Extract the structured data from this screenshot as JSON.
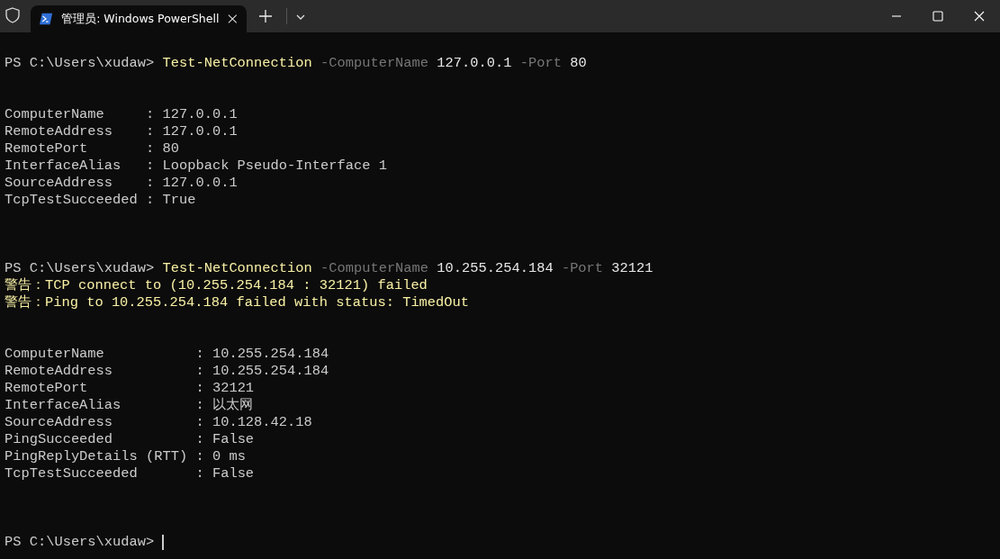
{
  "window": {
    "tab_title": "管理员: Windows PowerShell"
  },
  "lines": [
    {
      "kind": "prompt",
      "prompt": "PS C:\\Users\\xudaw>",
      "command": "Test-NetConnection",
      "args": [
        {
          "kind": "param",
          "text": "-ComputerName"
        },
        {
          "kind": "value",
          "text": "127.0.0.1"
        },
        {
          "kind": "param",
          "text": "-Port"
        },
        {
          "kind": "value",
          "text": "80"
        }
      ]
    },
    {
      "kind": "blank"
    },
    {
      "kind": "blank"
    },
    {
      "kind": "properties",
      "separator": ":",
      "items": [
        {
          "key": "ComputerName",
          "value": "127.0.0.1"
        },
        {
          "key": "RemoteAddress",
          "value": "127.0.0.1"
        },
        {
          "key": "RemotePort",
          "value": "80"
        },
        {
          "key": "InterfaceAlias",
          "value": "Loopback Pseudo-Interface 1"
        },
        {
          "key": "SourceAddress",
          "value": "127.0.0.1"
        },
        {
          "key": "TcpTestSucceeded",
          "value": "True"
        }
      ]
    },
    {
      "kind": "blank"
    },
    {
      "kind": "blank"
    },
    {
      "kind": "blank"
    },
    {
      "kind": "prompt",
      "prompt": "PS C:\\Users\\xudaw>",
      "command": "Test-NetConnection",
      "args": [
        {
          "kind": "param",
          "text": "-ComputerName"
        },
        {
          "kind": "value",
          "text": "10.255.254.184"
        },
        {
          "kind": "param",
          "text": "-Port"
        },
        {
          "kind": "value",
          "text": "32121"
        }
      ]
    },
    {
      "kind": "warning",
      "text": "警告：TCP connect to (10.255.254.184 : 32121) failed"
    },
    {
      "kind": "warning",
      "text": "警告：Ping to 10.255.254.184 failed with status: TimedOut"
    },
    {
      "kind": "blank"
    },
    {
      "kind": "blank"
    },
    {
      "kind": "properties",
      "separator": ":",
      "items": [
        {
          "key": "ComputerName",
          "value": "10.255.254.184"
        },
        {
          "key": "RemoteAddress",
          "value": "10.255.254.184"
        },
        {
          "key": "RemotePort",
          "value": "32121"
        },
        {
          "key": "InterfaceAlias",
          "value": "以太网"
        },
        {
          "key": "SourceAddress",
          "value": "10.128.42.18"
        },
        {
          "key": "PingSucceeded",
          "value": "False"
        },
        {
          "key": "PingReplyDetails (RTT)",
          "value": "0 ms"
        },
        {
          "key": "TcpTestSucceeded",
          "value": "False"
        }
      ]
    },
    {
      "kind": "blank"
    },
    {
      "kind": "blank"
    },
    {
      "kind": "blank"
    },
    {
      "kind": "prompt",
      "prompt": "PS C:\\Users\\xudaw>",
      "cursor": true
    }
  ]
}
